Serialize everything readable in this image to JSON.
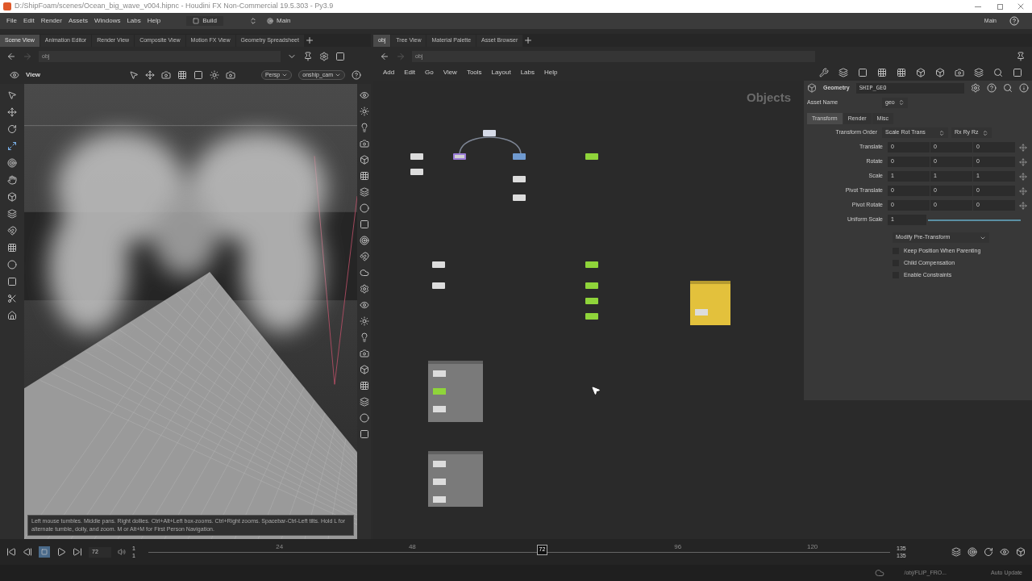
{
  "window": {
    "title": "D:/ShipFoam/scenes/Ocean_big_wave_v004.hipnc - Houdini FX Non-Commercial 19.5.303 - Py3.9"
  },
  "menu_bar": {
    "items": [
      "File",
      "Edit",
      "Render",
      "Assets",
      "Windows",
      "Labs",
      "Help"
    ],
    "desktop": "Build",
    "context": "Main",
    "right_desktop": "Main"
  },
  "left_pane": {
    "tabs": [
      {
        "label": "Scene View",
        "selected": true
      },
      {
        "label": "Animation Editor",
        "selected": false
      },
      {
        "label": "Render View",
        "selected": false
      },
      {
        "label": "Composite View",
        "selected": false
      },
      {
        "label": "Motion FX View",
        "selected": false
      },
      {
        "label": "Geometry Spreadsheet",
        "selected": false
      }
    ],
    "path": "obj",
    "viewer_label": "View",
    "camera_menus": [
      "Persp",
      "onship_cam"
    ],
    "help_text": "Left mouse tumbles. Middle pans. Right dollies. Ctrl+Alt+Left box-zooms. Ctrl+Right zooms. Spacebar-Ctrl-Left tilts. Hold L for alternate tumble, dolly, and zoom.    M or Alt+M for First Person Navigation."
  },
  "right_pane": {
    "tabs": [
      {
        "label": "obj",
        "selected": true
      },
      {
        "label": "Tree View",
        "selected": false
      },
      {
        "label": "Material Palette",
        "selected": false
      },
      {
        "label": "Asset Browser",
        "selected": false
      }
    ],
    "path": "obj",
    "menu": [
      "Add",
      "Edit",
      "Go",
      "View",
      "Tools",
      "Layout",
      "Labs",
      "Help"
    ],
    "network": {
      "context_label": "Objects",
      "nodes": [
        {
          "color": "#d6dbe8",
          "selected": false
        },
        {
          "color": "#dcdcdc",
          "selected": false
        },
        {
          "color": "#dcdcdc",
          "selected": false
        },
        {
          "color": "#d0d0d0",
          "selected": true
        },
        {
          "color": "#6f9ad0",
          "selected": false
        },
        {
          "color": "#dcdcdc",
          "selected": false
        },
        {
          "color": "#dcdcdc",
          "selected": false
        },
        {
          "color": "#8fd43a",
          "selected": false
        },
        {
          "color": "#dcdcdc",
          "selected": false
        },
        {
          "color": "#dcdcdc",
          "selected": false
        },
        {
          "color": "#8fd43a",
          "selected": false
        },
        {
          "color": "#8fd43a",
          "selected": false
        },
        {
          "color": "#8fd43a",
          "selected": false
        },
        {
          "color": "#8fd43a",
          "selected": false
        }
      ],
      "boxes": [
        {
          "color": "#7a7a7a",
          "nodes": [
            {
              "color": "#dcdcdc"
            },
            {
              "color": "#8fd43a"
            },
            {
              "color": "#dcdcdc"
            }
          ]
        },
        {
          "color": "#7a7a7a",
          "nodes": [
            {
              "color": "#dcdcdc"
            },
            {
              "color": "#dcdcdc"
            },
            {
              "color": "#dcdcdc"
            }
          ]
        },
        {
          "color": "#e3c13c",
          "nodes": [
            {
              "color": "#dcdcdc"
            }
          ]
        }
      ]
    },
    "parameters": {
      "node_type": "Geometry",
      "node_name": "SHIP_GEO",
      "asset_name_label": "Asset Name",
      "asset_name": "geo",
      "tabs": [
        {
          "label": "Transform",
          "selected": true
        },
        {
          "label": "Render",
          "selected": false
        },
        {
          "label": "Misc",
          "selected": false
        }
      ],
      "transform_order": {
        "label": "Transform Order",
        "values": [
          "Scale Rot Trans",
          "Rx Ry Rz"
        ]
      },
      "vectors": [
        {
          "label": "Translate",
          "values": [
            "0",
            "0",
            "0"
          ]
        },
        {
          "label": "Rotate",
          "values": [
            "0",
            "0",
            "0"
          ]
        },
        {
          "label": "Scale",
          "values": [
            "1",
            "1",
            "1"
          ]
        },
        {
          "label": "Pivot Translate",
          "values": [
            "0",
            "0",
            "0"
          ]
        },
        {
          "label": "Pivot Rotate",
          "values": [
            "0",
            "0",
            "0"
          ]
        }
      ],
      "uniform_scale": {
        "label": "Uniform Scale",
        "value": "1",
        "level": 1.0
      },
      "pre_transform_menu": "Modify Pre-Transform",
      "checkboxes": [
        {
          "label": "Keep Position When Parenting",
          "checked": false
        },
        {
          "label": "Child Compensation",
          "checked": false
        },
        {
          "label": "Enable Constraints",
          "checked": false
        }
      ]
    }
  },
  "timeline": {
    "frame": "72",
    "range_start": [
      "1",
      "1"
    ],
    "ticks": [
      "24",
      "48",
      "96",
      "120"
    ],
    "marker": "72",
    "level": 0.53,
    "range_end": [
      "135",
      "135"
    ]
  },
  "status_bar": {
    "path": "/obj/FLIP_FRO...",
    "update_mode": "Auto Update"
  }
}
